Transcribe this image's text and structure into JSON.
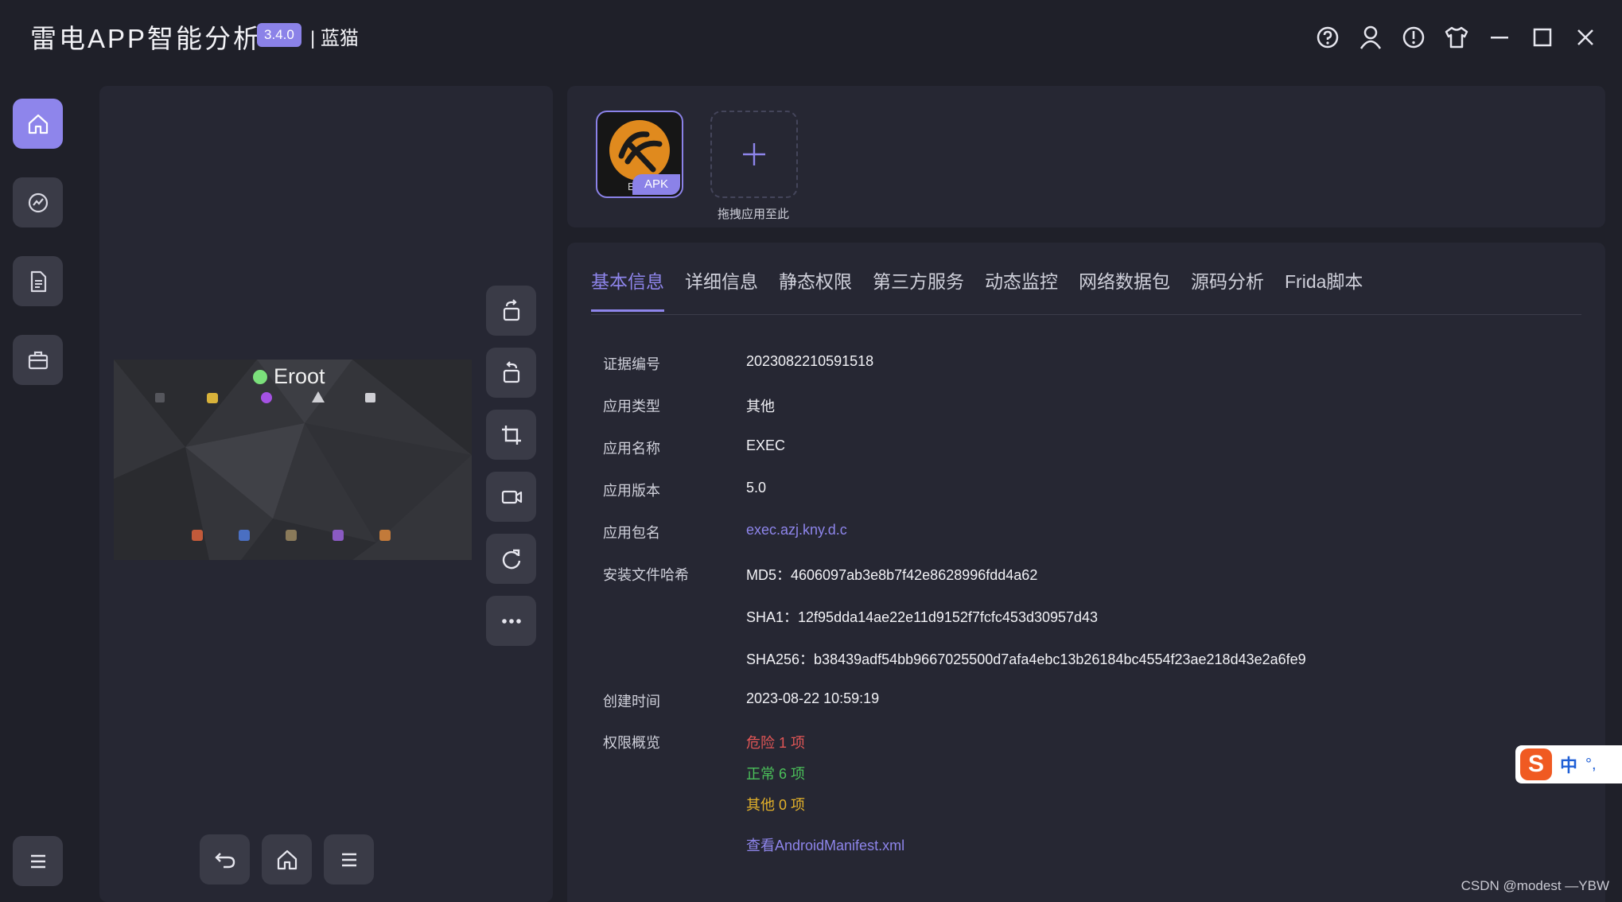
{
  "app": {
    "title": "雷电APP智能分析",
    "version": "3.4.0",
    "user": "| 蓝猫"
  },
  "window_controls": [
    "help-icon",
    "user-icon",
    "info-icon",
    "shirt-icon",
    "minimize-icon",
    "maximize-icon",
    "close-icon"
  ],
  "nav": [
    "home-icon",
    "analysis-icon",
    "report-icon",
    "toolbox-icon",
    "menu-icon"
  ],
  "device": {
    "overlay_text": "Eroot"
  },
  "apk": {
    "badge": "APK",
    "icon_text": "EXE",
    "add_label": "拖拽应用至此"
  },
  "tabs": [
    "基本信息",
    "详细信息",
    "静态权限",
    "第三方服务",
    "动态监控",
    "网络数据包",
    "源码分析",
    "Frida脚本"
  ],
  "info": {
    "cert_label": "证据编号",
    "cert_value": "2023082210591518",
    "type_label": "应用类型",
    "type_value": "其他",
    "name_label": "应用名称",
    "name_value": "EXEC",
    "version_label": "应用版本",
    "version_value": "5.0",
    "package_label": "应用包名",
    "package_value": "exec.azj.kny.d.c",
    "hash_label": "安装文件哈希",
    "md5": "MD5：4606097ab3e8b7f42e8628996fdd4a62",
    "sha1": "SHA1：12f95dda14ae22e11d9152f7fcfc453d30957d43",
    "sha256": "SHA256：b38439adf54bb9667025500d7afa4ebc13b26184bc4554f23ae218d43e2a6fe9",
    "created_label": "创建时间",
    "created_value": "2023-08-22 10:59:19",
    "perm_label": "权限概览",
    "perm_danger": "危险 1 项",
    "perm_normal": "正常 6 项",
    "perm_other": "其他 0 项",
    "manifest_link": "查看AndroidManifest.xml"
  },
  "ime": {
    "logo": "S",
    "lang": "中",
    "punct": "°,"
  },
  "watermark": "CSDN @modest —YBW",
  "colors": {
    "accent": "#8e85eb",
    "bg": "#1f2029",
    "panel": "#262733",
    "danger": "#e15656",
    "normal": "#4bc05a",
    "other": "#e4b22a"
  }
}
